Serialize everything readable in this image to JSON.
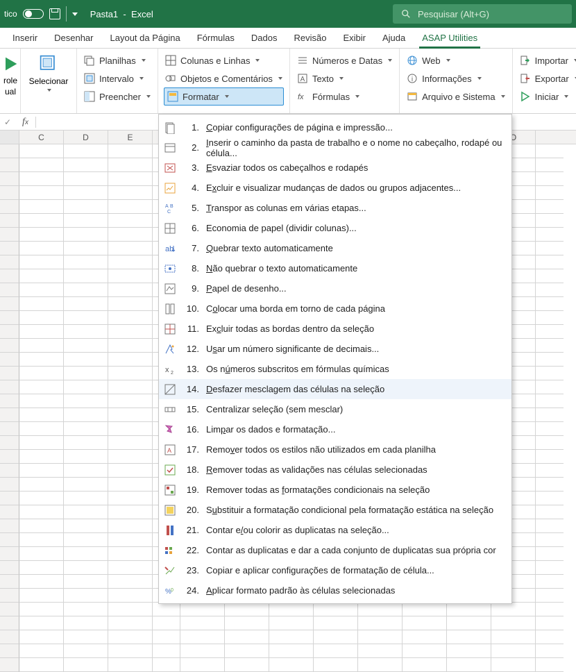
{
  "titlebar": {
    "autosave": "tico",
    "filename": "Pasta1",
    "appname": "Excel",
    "search_placeholder": "Pesquisar (Alt+G)"
  },
  "tabs": [
    "Inserir",
    "Desenhar",
    "Layout da Página",
    "Fórmulas",
    "Dados",
    "Revisão",
    "Exibir",
    "Ajuda",
    "ASAP Utilities"
  ],
  "active_tab": 8,
  "ribbon": {
    "group_left1": {
      "label1": "role",
      "label2": "ual"
    },
    "selecionar": "Selecionar",
    "col1": [
      "Planilhas",
      "Intervalo",
      "Preencher"
    ],
    "col2": [
      "Colunas e Linhas",
      "Objetos e Comentários",
      "Formatar"
    ],
    "col3": [
      "Números e Datas",
      "Texto",
      "Fórmulas"
    ],
    "col4": [
      "Web",
      "Informações",
      "Arquivo e Sistema"
    ],
    "col5": [
      "Importar",
      "Exportar",
      "Iniciar"
    ]
  },
  "columns": [
    "",
    "C",
    "D",
    "E",
    "",
    "",
    "",
    "",
    "",
    "",
    "",
    "",
    "O",
    ""
  ],
  "menu": [
    {
      "num": "1.",
      "label": "Copiar configurações de página e impressão...",
      "u": 0
    },
    {
      "num": "2.",
      "label": "Inserir o caminho da pasta de trabalho e o nome no cabeçalho, rodapé ou célula...",
      "u": 0
    },
    {
      "num": "3.",
      "label": "Esvaziar todos os cabeçalhos e rodapés",
      "u": 0
    },
    {
      "num": "4.",
      "label": "Excluir e visualizar mudanças de dados ou grupos adjacentes...",
      "u": 1
    },
    {
      "num": "5.",
      "label": "Transpor as colunas em várias etapas...",
      "u": 0
    },
    {
      "num": "6.",
      "label": "Economia de papel (dividir colunas)...",
      "u": -1
    },
    {
      "num": "7.",
      "label": "Quebrar texto automaticamente",
      "u": 0
    },
    {
      "num": "8.",
      "label": "Não quebrar o texto automaticamente",
      "u": 0
    },
    {
      "num": "9.",
      "label": "Papel de desenho...",
      "u": 0
    },
    {
      "num": "10.",
      "label": "Colocar uma borda em torno de cada página",
      "u": 1
    },
    {
      "num": "11.",
      "label": "Excluir todas as bordas dentro da seleção",
      "u": 2
    },
    {
      "num": "12.",
      "label": "Usar um número significante de decimais...",
      "u": 1
    },
    {
      "num": "13.",
      "label": "Os números subscritos em fórmulas químicas",
      "u": 4
    },
    {
      "num": "14.",
      "label": "Desfazer mesclagem das células na seleção",
      "u": 0
    },
    {
      "num": "15.",
      "label": "Centralizar seleção (sem mesclar)",
      "u": -1
    },
    {
      "num": "16.",
      "label": "Limpar os dados e formatação...",
      "u": 3
    },
    {
      "num": "17.",
      "label": "Remover todos os estilos não utilizados em cada planilha",
      "u": 4
    },
    {
      "num": "18.",
      "label": "Remover todas as validações nas células selecionadas",
      "u": 0
    },
    {
      "num": "19.",
      "label": "Remover todas as formatações condicionais na seleção",
      "u": 17
    },
    {
      "num": "20.",
      "label": "Substituir a formatação condicional pela formatação estática na seleção",
      "u": 1
    },
    {
      "num": "21.",
      "label": "Contar e/ou colorir as duplicatas na seleção...",
      "u": 8
    },
    {
      "num": "22.",
      "label": "Contar as duplicatas e dar a cada conjunto de duplicatas sua própria cor",
      "u": -1
    },
    {
      "num": "23.",
      "label": "Copiar e aplicar configurações de formatação de célula...",
      "u": -1
    },
    {
      "num": "24.",
      "label": "Aplicar formato padrão às células selecionadas",
      "u": 0
    }
  ],
  "menu_hover": 13
}
